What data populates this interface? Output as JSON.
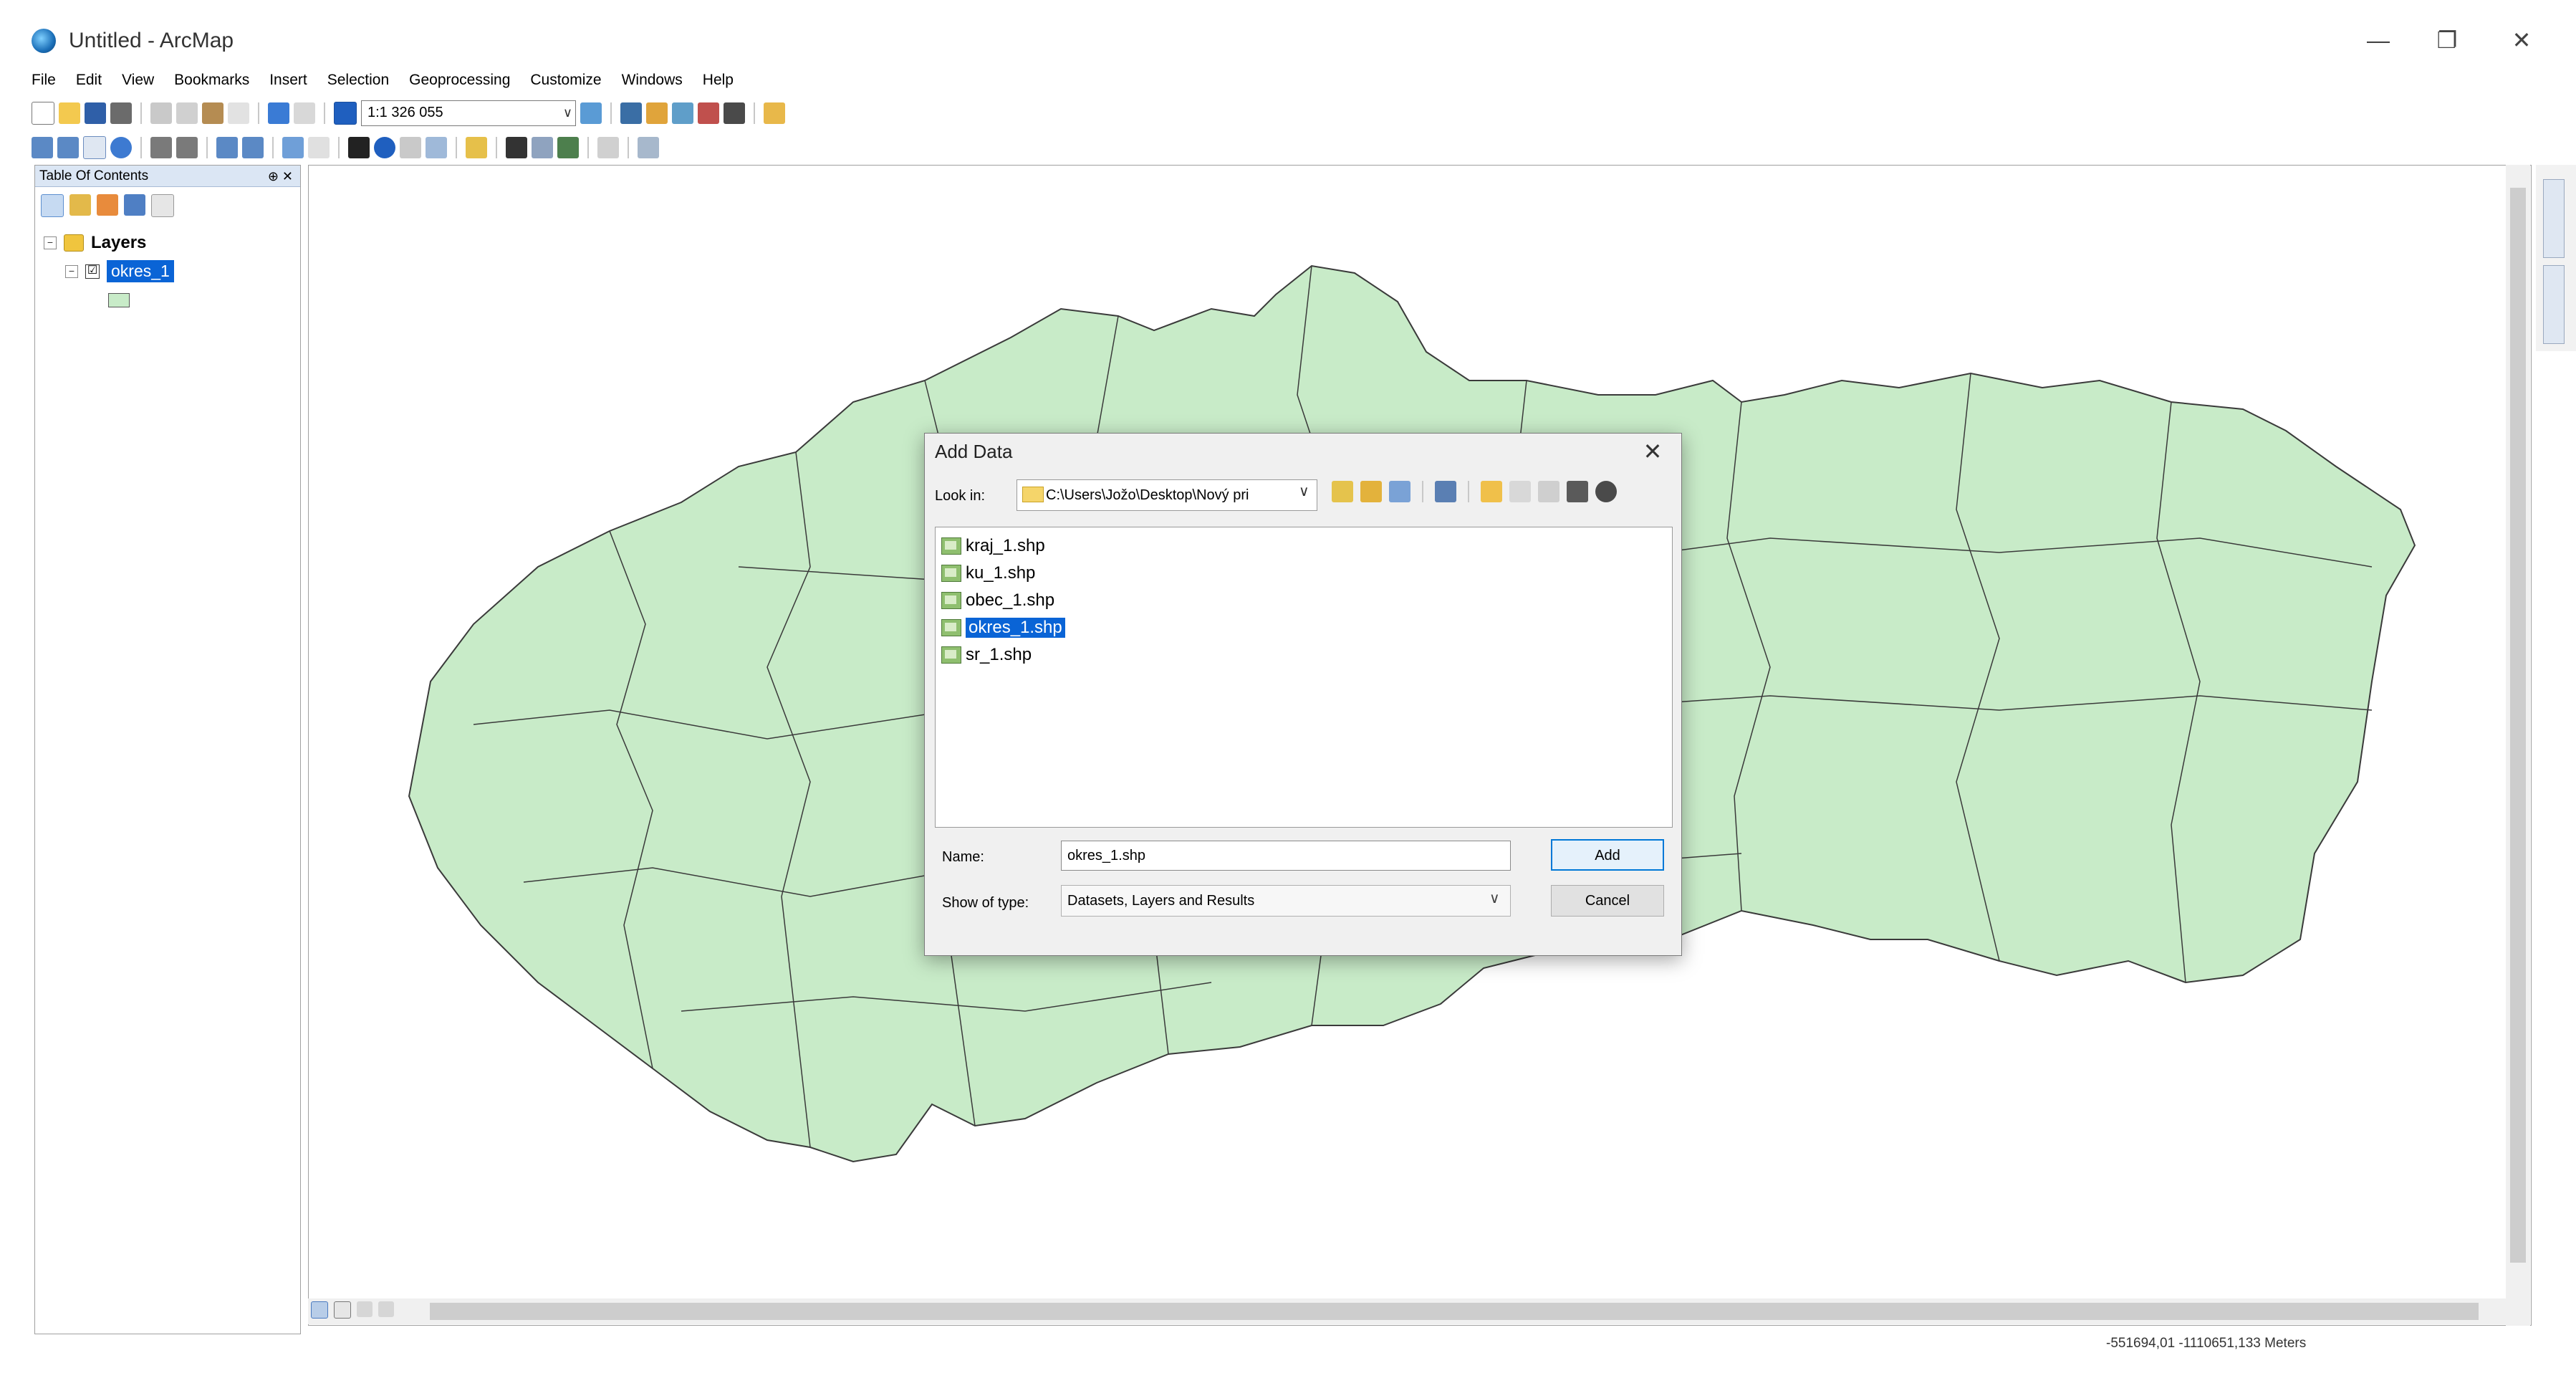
{
  "window": {
    "title": "Untitled - ArcMap",
    "minimize": "—",
    "maximize": "❐",
    "close": "✕"
  },
  "menu": [
    "File",
    "Edit",
    "View",
    "Bookmarks",
    "Insert",
    "Selection",
    "Geoprocessing",
    "Customize",
    "Windows",
    "Help"
  ],
  "toolbar": {
    "scale": "1:1 326 055"
  },
  "toc": {
    "title": "Table Of Contents",
    "pin": "⊕ ✕",
    "group": "Layers",
    "layer": "okres_1",
    "layer_checked": "☑",
    "expander": "−",
    "swatch_color": "#c8ebc8"
  },
  "map": {
    "fill_color": "#c8ebc8",
    "stroke_color": "#3a3a3a",
    "status_coords": "-551694,01 -1110651,133 Meters"
  },
  "dialog": {
    "title": "Add Data",
    "close": "✕",
    "look_in_label": "Look in:",
    "look_in_value": "C:\\Users\\Jožo\\Desktop\\Nový pri",
    "dropdown_glyph": "∨",
    "files": [
      {
        "name": "kraj_1.shp",
        "selected": false
      },
      {
        "name": "ku_1.shp",
        "selected": false
      },
      {
        "name": "obec_1.shp",
        "selected": false
      },
      {
        "name": "okres_1.shp",
        "selected": true
      },
      {
        "name": "sr_1.shp",
        "selected": false
      }
    ],
    "name_label": "Name:",
    "name_value": "okres_1.shp",
    "type_label": "Show of type:",
    "type_value": "Datasets, Layers and Results",
    "add_label": "Add",
    "cancel_label": "Cancel"
  }
}
